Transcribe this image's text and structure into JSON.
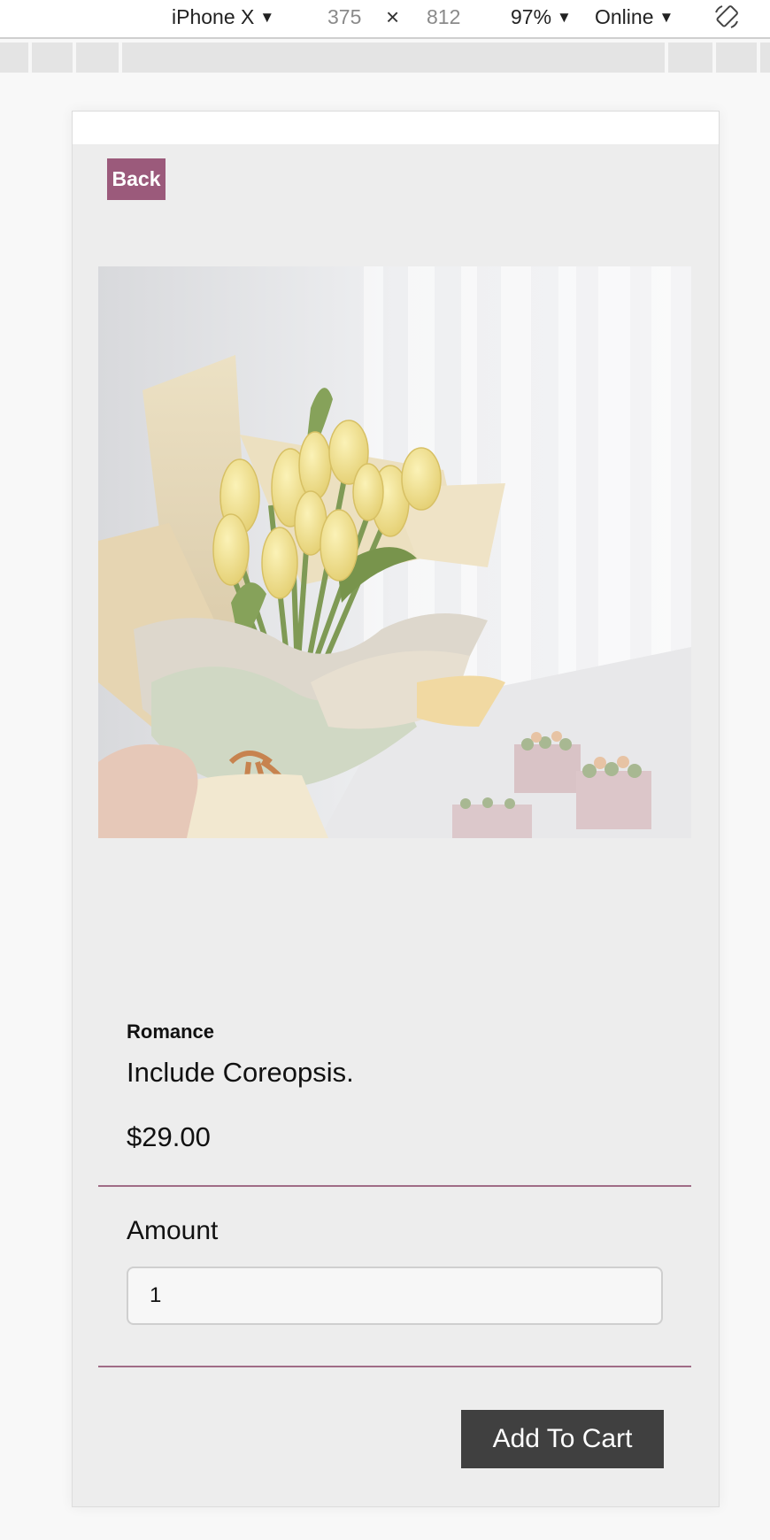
{
  "devtools": {
    "device": "iPhone X",
    "width": "375",
    "times": "×",
    "height": "812",
    "zoom": "97%",
    "network": "Online"
  },
  "nav": {
    "back_label": "Back"
  },
  "product": {
    "image_alt": "Bouquet of yellow tulips wrapped in cream paper",
    "category": "Romance",
    "description": "Include Coreopsis.",
    "price": "$29.00"
  },
  "amount": {
    "label": "Amount",
    "value": "1"
  },
  "cart": {
    "button_label": "Add To Cart"
  },
  "colors": {
    "accent": "#9b5a7b",
    "divider": "#a06c86",
    "button": "#404040"
  }
}
